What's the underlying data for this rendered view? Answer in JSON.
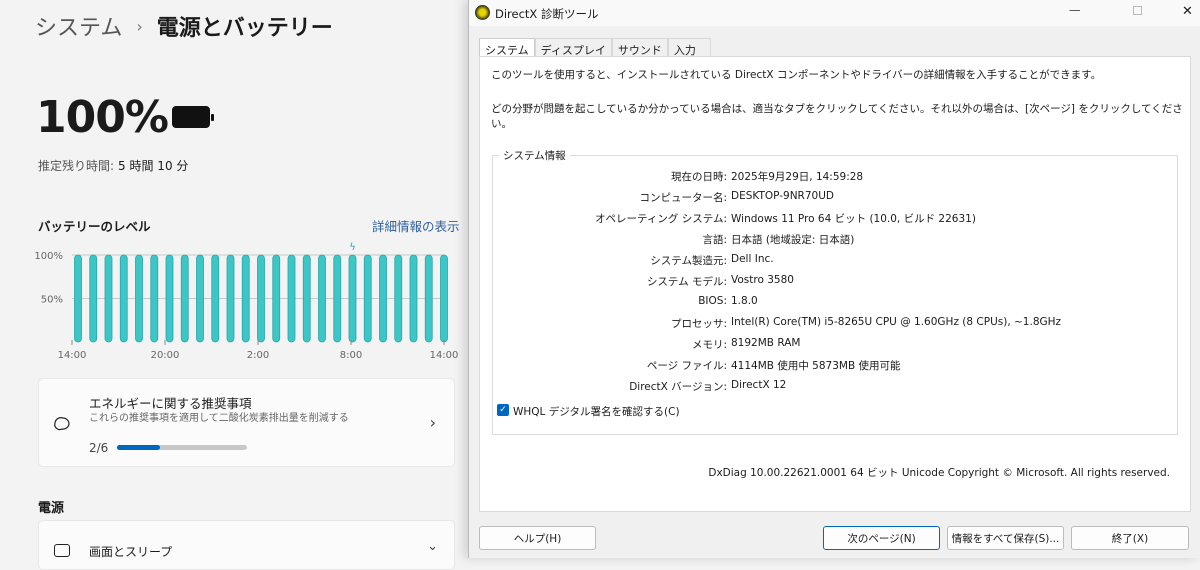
{
  "settings": {
    "breadcrumb": {
      "parent": "システム",
      "current": "電源とバッテリー"
    },
    "battery_percent": "100%",
    "remaining_label": "推定残り時間:",
    "remaining_value": "5 時間 10 分",
    "level_title": "バッテリーのレベル",
    "details_link": "詳細情報の表示",
    "energy": {
      "title": "エネルギーに関する推奨事項",
      "subtitle": "これらの推奨事項を適用して二酸化炭素排出量を削減する",
      "count": "2/6",
      "progress": 0.333
    },
    "power_heading": "電源",
    "sleep_label": "画面とスリープ"
  },
  "chart_data": {
    "type": "bar",
    "title": "バッテリーのレベル",
    "yticks": [
      "100%",
      "50%"
    ],
    "ylim": [
      0,
      100
    ],
    "xticks": [
      "14:00",
      "20:00",
      "2:00",
      "8:00",
      "14:00"
    ],
    "values": [
      100,
      100,
      100,
      100,
      100,
      100,
      100,
      100,
      100,
      100,
      100,
      100,
      100,
      100,
      100,
      100,
      100,
      100,
      100,
      100,
      100,
      100,
      100,
      100,
      100
    ],
    "charging_index": 18,
    "bar_color": "#3cc6c6"
  },
  "dx": {
    "title": "DirectX 診断ツール",
    "tabs": [
      "システム",
      "ディスプレイ",
      "サウンド",
      "入力"
    ],
    "intro1": "このツールを使用すると、インストールされている DirectX コンポーネントやドライバーの詳細情報を入手することができます。",
    "intro2": "どの分野が問題を起こしているか分かっている場合は、適当なタブをクリックしてください。それ以外の場合は、[次ページ] をクリックしてください。",
    "group": "システム情報",
    "rows": [
      {
        "k": "現在の日時:",
        "v": "2025年9月29日, 14:59:28"
      },
      {
        "k": "コンピューター名:",
        "v": "DESKTOP-9NR70UD"
      },
      {
        "k": "オペレーティング システム:",
        "v": "Windows 11 Pro 64 ビット (10.0, ビルド 22631)"
      },
      {
        "k": "言語:",
        "v": "日本語 (地域設定: 日本語)"
      },
      {
        "k": "システム製造元:",
        "v": "Dell Inc."
      },
      {
        "k": "システム モデル:",
        "v": "Vostro 3580"
      },
      {
        "k": "BIOS:",
        "v": "1.8.0"
      },
      {
        "k": "プロセッサ:",
        "v": "Intel(R) Core(TM) i5-8265U CPU @ 1.60GHz (8 CPUs), ~1.8GHz"
      },
      {
        "k": "メモリ:",
        "v": "8192MB RAM"
      },
      {
        "k": "ページ ファイル:",
        "v": "4114MB 使用中 5873MB 使用可能"
      },
      {
        "k": "DirectX バージョン:",
        "v": "DirectX 12"
      }
    ],
    "whql": "WHQL デジタル署名を確認する(C)",
    "footer": "DxDiag 10.00.22621.0001 64 ビット Unicode  Copyright © Microsoft. All rights reserved.",
    "buttons": {
      "help": "ヘルプ(H)",
      "next": "次のページ(N)",
      "save": "情報をすべて保存(S)...",
      "exit": "終了(X)"
    }
  }
}
